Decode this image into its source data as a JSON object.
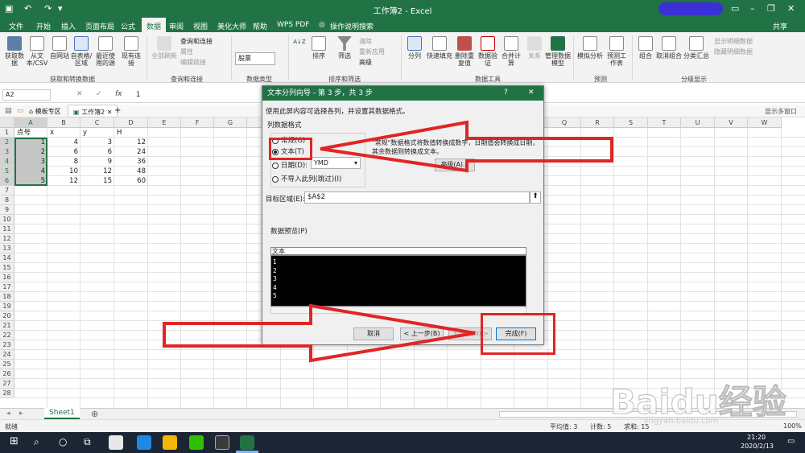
{
  "titlebar": {
    "title": "工作簿2 - Excel",
    "user": "共享"
  },
  "tabs": [
    "文件",
    "开始",
    "插入",
    "页面布局",
    "公式",
    "数据",
    "审阅",
    "视图",
    "美化大师",
    "帮助",
    "WPS PDF",
    "操作说明搜索"
  ],
  "active_tab": "数据",
  "ribbon": {
    "get_data": [
      "获取数据",
      "从文本/CSV",
      "自网站",
      "自表格/区域",
      "最近使用的源",
      "现有连接"
    ],
    "group_get": "获取和转换数据",
    "refresh": "全部刷新",
    "query_items": [
      "查询和连接",
      "属性",
      "编辑链接"
    ],
    "group_query": "查询和连接",
    "stock": "股票",
    "group_datatype": "数据类型",
    "sort_az": "A↓Z",
    "sort": "排序",
    "filter": "筛选",
    "filter_items": [
      "清除",
      "重新应用",
      "高级"
    ],
    "group_sort": "排序和筛选",
    "tools": [
      "分列",
      "快速填充",
      "删除重复值",
      "数据验证",
      "合并计算",
      "关系",
      "管理数据模型"
    ],
    "group_tools": "数据工具",
    "forecast": [
      "模拟分析",
      "预测工作表"
    ],
    "group_forecast": "预测",
    "outline": [
      "组合",
      "取消组合",
      "分类汇总"
    ],
    "outline_side": [
      "显示明细数据",
      "隐藏明细数据"
    ],
    "group_outline": "分级显示"
  },
  "formula_bar": {
    "namebox": "A2",
    "value": "1",
    "fx": "fx"
  },
  "doc_tabs": [
    "模板专区",
    "工作簿2"
  ],
  "doc_right": "显示多窗口",
  "columns": [
    "A",
    "B",
    "C",
    "D",
    "E",
    "F",
    "G",
    "H",
    "I",
    "J",
    "K",
    "L",
    "M",
    "N",
    "O",
    "P",
    "Q",
    "R",
    "S",
    "T",
    "U",
    "V",
    "W"
  ],
  "rows": [
    "1",
    "2",
    "3",
    "4",
    "5",
    "6",
    "7",
    "8",
    "9",
    "10",
    "11",
    "12",
    "13",
    "14",
    "15",
    "16",
    "17",
    "18",
    "19",
    "20",
    "21",
    "22",
    "23",
    "24",
    "25",
    "26",
    "27",
    "28"
  ],
  "sheet": {
    "headers": [
      "点号",
      "x",
      "y",
      "H"
    ],
    "data": [
      [
        "1",
        "4",
        "3",
        "12"
      ],
      [
        "2",
        "6",
        "6",
        "24"
      ],
      [
        "3",
        "8",
        "9",
        "36"
      ],
      [
        "4",
        "10",
        "12",
        "48"
      ],
      [
        "5",
        "12",
        "15",
        "60"
      ]
    ]
  },
  "sheet_tab": "Sheet1",
  "status": {
    "ready": "就绪",
    "avg": "平均值: 3",
    "count": "计数: 5",
    "sum": "求和: 15",
    "zoom": "100%"
  },
  "dialog": {
    "title": "文本分列向导 - 第 3 步，共 3 步",
    "help": "?",
    "close": "✕",
    "intro": "使用此屏内容可选择各列，并设置其数据格式。",
    "section": "列数据格式",
    "radio_general": "常规(G)",
    "radio_text": "文本(T)",
    "radio_date": "日期(D):",
    "date_value": "YMD",
    "radio_skip": "不导入此列(跳过)(I)",
    "desc": "\"常规\"数据格式将数值转换成数字，日期值会转换成日期，其余数据则转换成文本。",
    "advanced": "高级(A)...",
    "dest_label": "目标区域(E):",
    "dest_value": "$A$2",
    "preview_label": "数据预览(P)",
    "preview_header": "文本",
    "preview_rows": [
      "1",
      "2",
      "3",
      "4",
      "5"
    ],
    "btn_cancel": "取消",
    "btn_back": "< 上一步(B)",
    "btn_next": "下一步(N) >",
    "btn_finish": "完成(F)"
  },
  "taskbar": {
    "time": "21:20",
    "date": "2020/2/13"
  },
  "watermark": "Baidu经验",
  "watermark_url": "jingyan.baidu.com"
}
